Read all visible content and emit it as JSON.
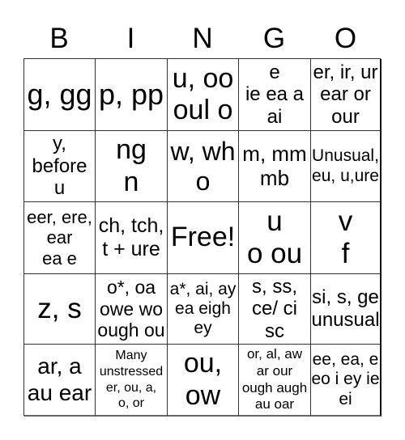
{
  "header": {
    "letters": [
      "B",
      "I",
      "N",
      "G",
      "O"
    ]
  },
  "card": {
    "rows": [
      [
        "g, gg",
        "p, pp",
        "u, oo\noul o",
        "e\nie ea a\nai",
        "er, ir, ur\near or\nour"
      ],
      [
        "y,\nbefore\nu",
        "ng\nn",
        "w, wh\no",
        "m, mm\nmb",
        "Unusual,\neu, u,ure"
      ],
      [
        "eer, ere,\near\nea e",
        "ch, tch,\nt + ure",
        "Free!",
        "u\no ou",
        "v\nf"
      ],
      [
        "z, s",
        "o*, oa\nowe wo\nough ou",
        "a*, ai, ay\nea eigh\ney",
        "s, ss,\nce/ ci\nsc",
        "si, s, ge\nunusual"
      ],
      [
        "ar, a\nau ear",
        "Many\nunstressed\ner, ou, a,\no, or",
        "ou,\now",
        "or, al, aw\nar our\nough augh\nau oar",
        "ee, ea, e\neo i ey ie\nei"
      ]
    ]
  }
}
